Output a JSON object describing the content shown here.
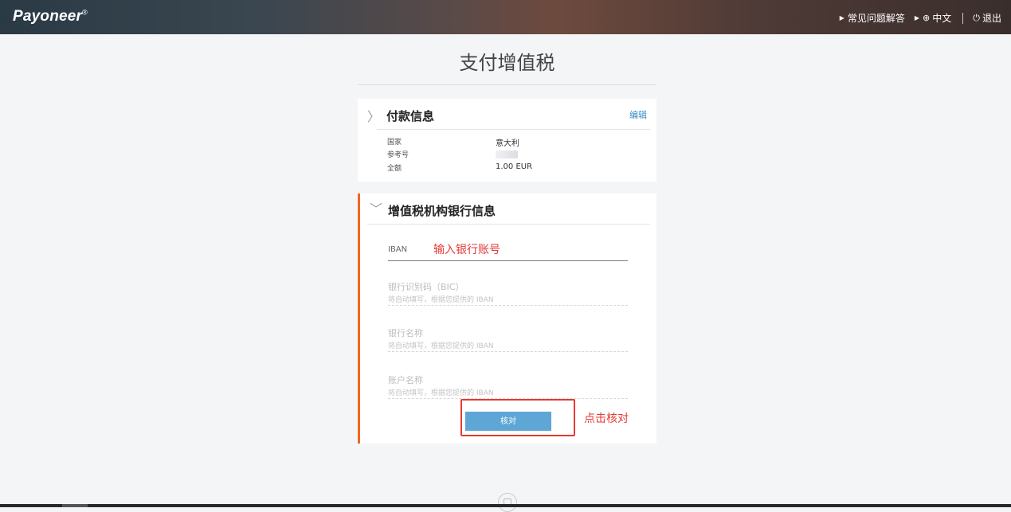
{
  "header": {
    "logo": "Payoneer",
    "logo_mark": "®",
    "nav": {
      "faq": "常见问题解答",
      "language": "中文",
      "logout": "退出"
    }
  },
  "page": {
    "title": "支付增值税"
  },
  "payment_info": {
    "title": "付款信息",
    "edit": "编辑",
    "rows": [
      {
        "label": "国家",
        "value": "意大利"
      },
      {
        "label": "参考号",
        "value": ""
      },
      {
        "label": "全额",
        "value": "1.00 EUR"
      }
    ]
  },
  "bank_info": {
    "title": "增值税机构银行信息",
    "iban": {
      "label": "IBAN",
      "annotation": "输入银行账号"
    },
    "fields": [
      {
        "label": "银行识别码（BIC）",
        "help": "将自动填写，根据您提供的 IBAN"
      },
      {
        "label": "银行名称",
        "help": "将自动填写，根据您提供的 IBAN"
      },
      {
        "label": "账户名称",
        "help": "将自动填写，根据您提供的 IBAN"
      }
    ],
    "verify_button": "核对",
    "click_annotation": "点击核对"
  },
  "colors": {
    "accent": "#f26522",
    "button": "#5da6d6",
    "link": "#3a8cc8",
    "annotation": "#e53935"
  }
}
